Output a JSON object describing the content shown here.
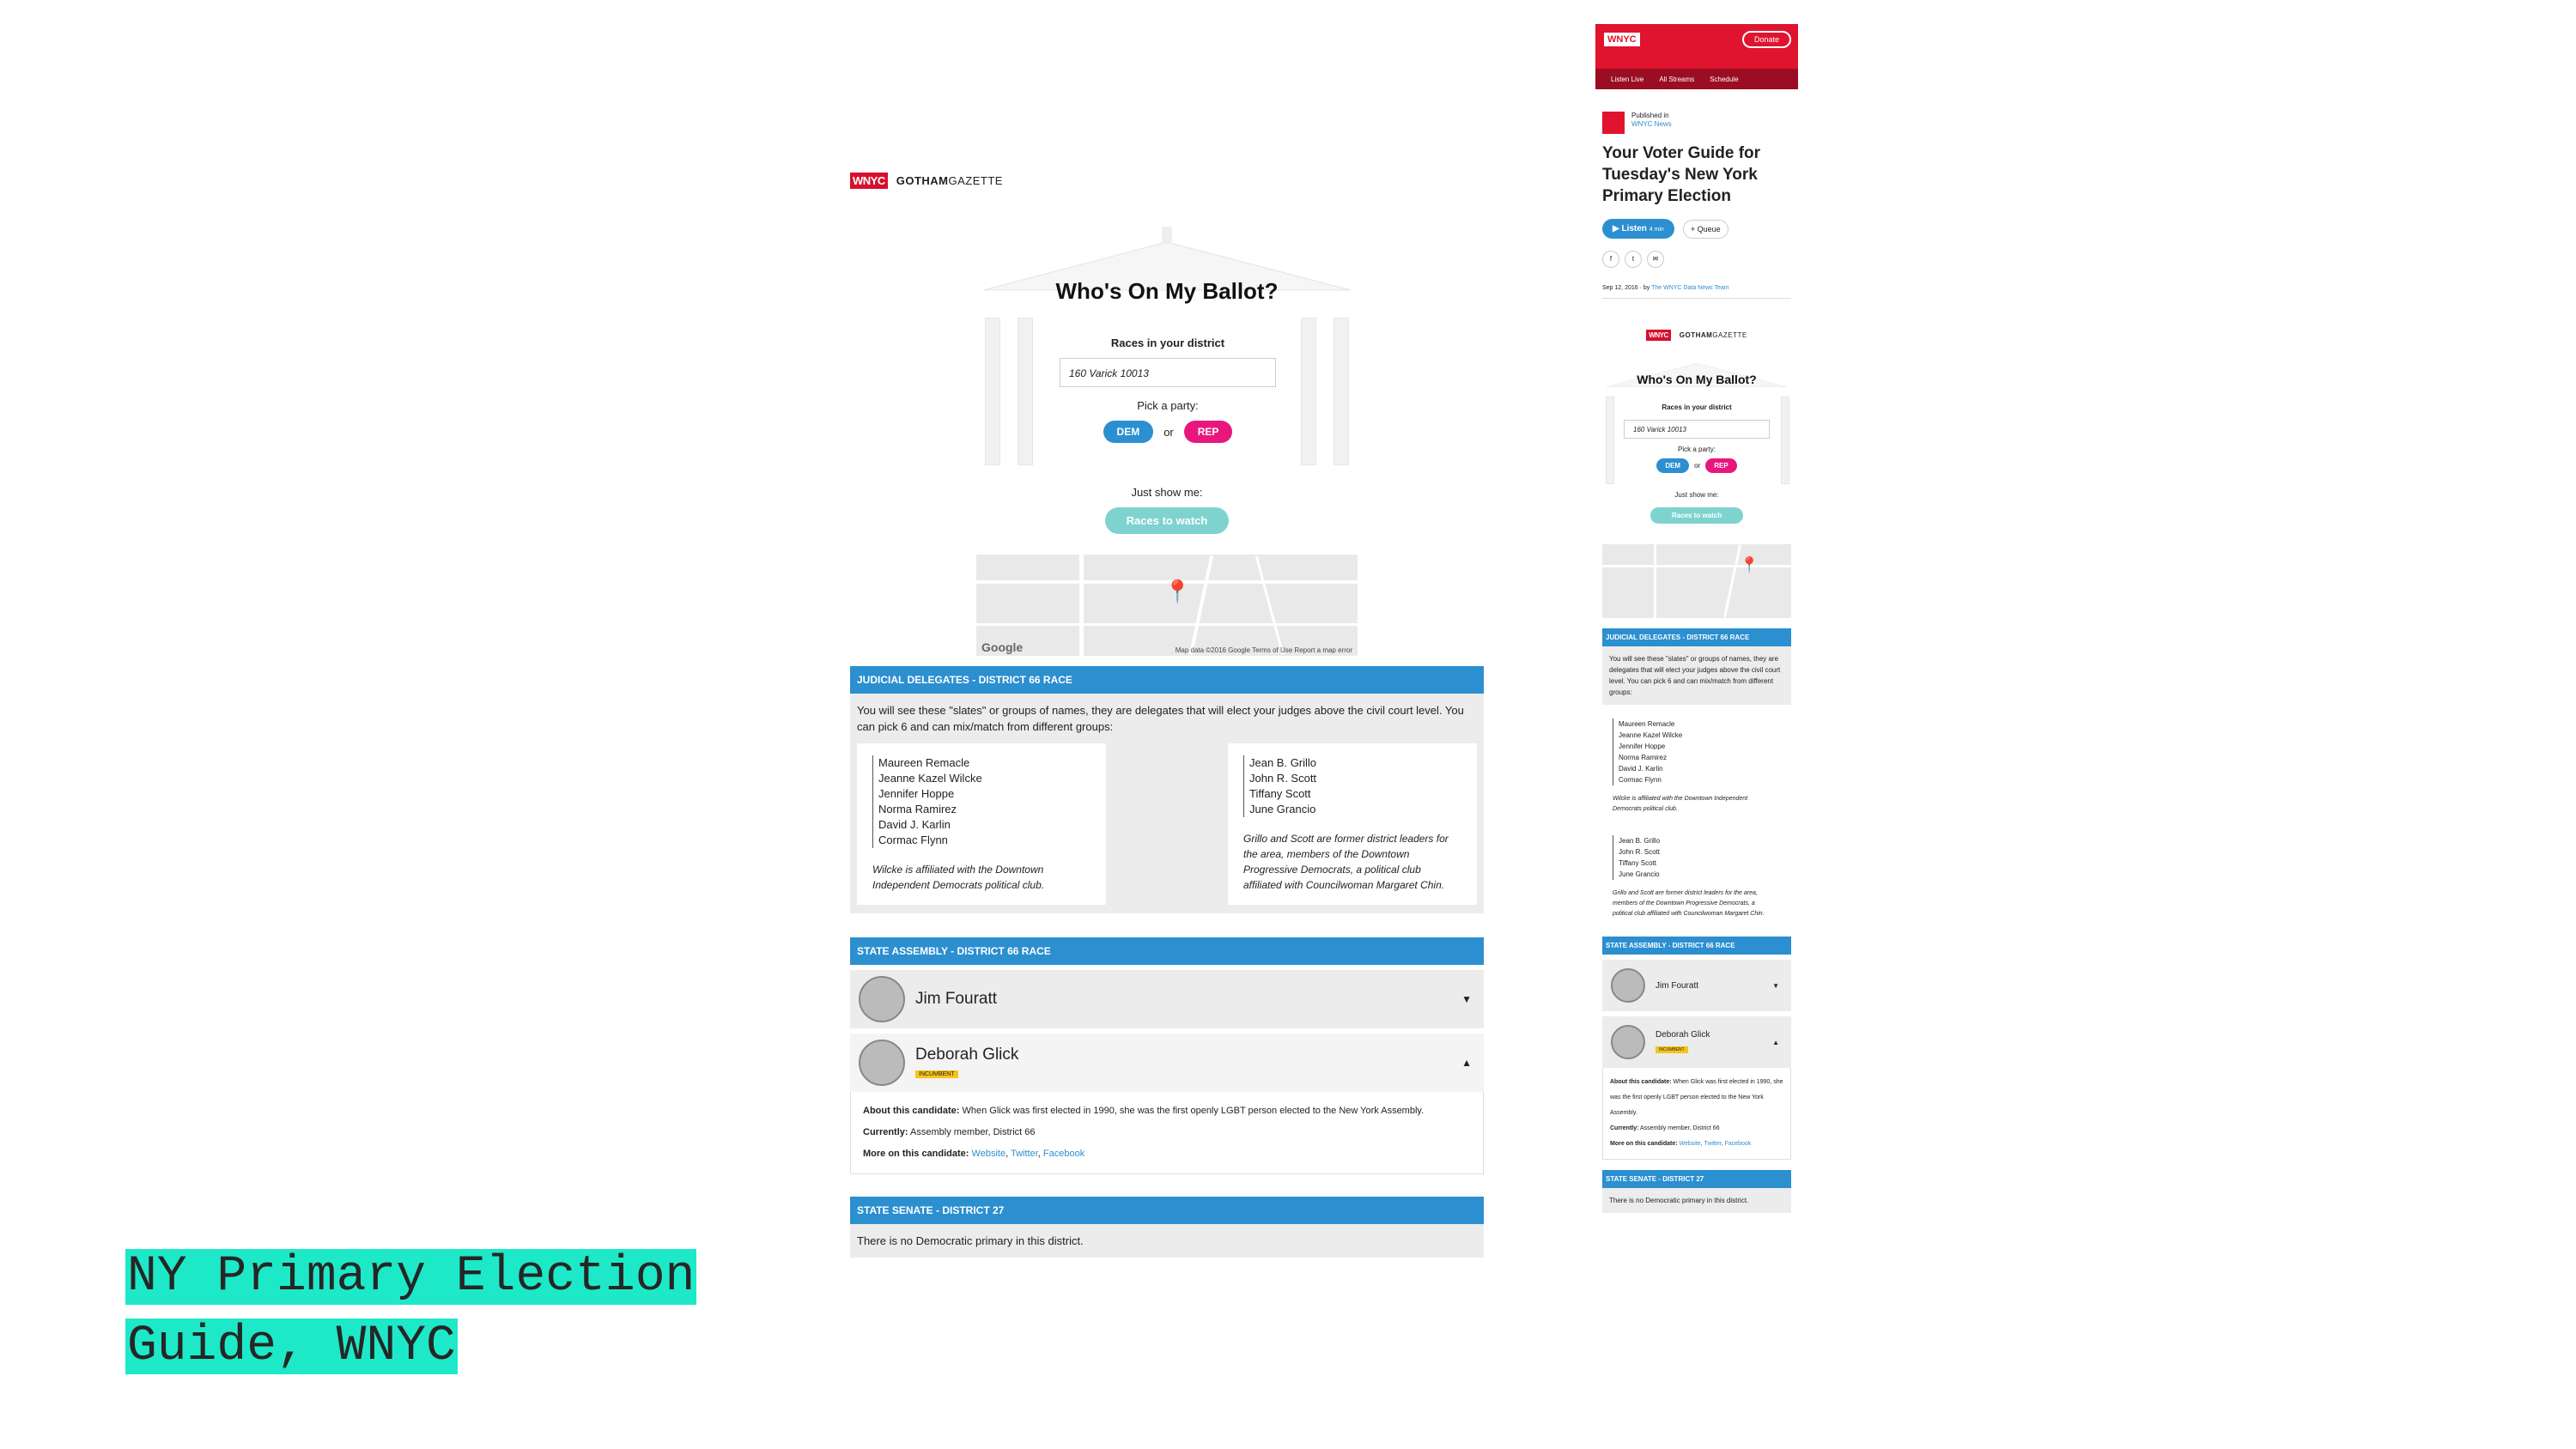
{
  "caption": {
    "line1": "NY Primary Election",
    "line2": "Guide, WNYC"
  },
  "logos": {
    "wnyc": "WNYC",
    "gotham_bold": "GOTHAM",
    "gotham_light": "GAZETTE"
  },
  "guide": {
    "title": "Who's On My Ballot?",
    "races_label": "Races in your district",
    "address_value": "160 Varick 10013",
    "pick_party": "Pick a party:",
    "dem": "DEM",
    "or": "or",
    "rep": "REP",
    "just_show": "Just show me:",
    "races_to_watch": "Races to watch",
    "map_credit": "Map data ©2016 Google   Terms of Use   Report a map error",
    "google": "Google"
  },
  "judicial": {
    "header": "JUDICIAL DELEGATES - DISTRICT 66 RACE",
    "intro": "You will see these \"slates\" or groups of names, they are delegates that will elect your judges above the civil court level. You can pick 6 and can mix/match from different groups:",
    "slate1": {
      "names": [
        "Maureen Remacle",
        "Jeanne Kazel Wilcke",
        "Jennifer Hoppe",
        "Norma Ramirez",
        "David J. Karlin",
        "Cormac Flynn"
      ],
      "note": "Wilcke is affiliated with the Downtown Independent Democrats political club."
    },
    "slate2": {
      "names": [
        "Jean B. Grillo",
        "John R. Scott",
        "Tiffany Scott",
        "June Grancio"
      ],
      "note": "Grillo and Scott are former district leaders for the area, members of the Downtown Progressive Democrats, a political club affiliated with Councilwoman Margaret Chin."
    }
  },
  "assembly": {
    "header": "STATE ASSEMBLY - DISTRICT 66 RACE",
    "cand1": "Jim Fouratt",
    "cand2": "Deborah Glick",
    "badge": "INCUMBENT",
    "about_label": "About this candidate:",
    "about_text": "When Glick was first elected in 1990, she was the first openly LGBT person elected to the New York Assembly.",
    "currently_label": "Currently:",
    "currently_text": "Assembly member, District 66",
    "more_label": "More on this candidate:",
    "links": [
      "Website",
      "Twitter",
      "Facebook"
    ]
  },
  "senate": {
    "header": "STATE SENATE - DISTRICT 27",
    "text": "There is no Democratic primary in this district."
  },
  "mobile": {
    "donate": "Donate",
    "nav": [
      "Listen Live",
      "All Streams",
      "Schedule"
    ],
    "published_in": "Published in",
    "section": "WNYC News",
    "title": "Your Voter Guide for Tuesday's New York Primary Election",
    "listen": "Listen",
    "listen_time": "4 min",
    "queue": "+ Queue",
    "date": "Sep 12, 2016 · by",
    "author": "The WNYC Data News Team"
  },
  "colors": {
    "accent_blue": "#2b8fd0",
    "dem": "#2b8fd0",
    "rep": "#e8177e",
    "watch": "#7ed3cf",
    "wnyc_red": "#e0142e",
    "caption_highlight": "#1de9c8"
  }
}
